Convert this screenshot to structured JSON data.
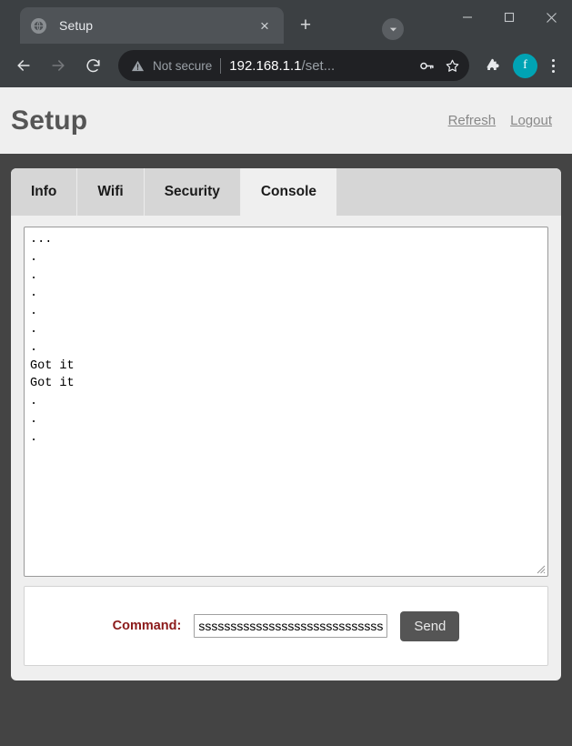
{
  "browser": {
    "tab": {
      "favicon": "globe-icon",
      "title": "Setup",
      "close_label": "×"
    },
    "new_tab_label": "+",
    "tab_search_icon": "chevron-down-icon",
    "window_controls": {
      "minimize": "—",
      "maximize": "☐",
      "close": "✕"
    },
    "toolbar": {
      "back_icon": "arrow-left-icon",
      "forward_icon": "arrow-right-icon",
      "reload_icon": "reload-icon",
      "security_icon": "warning-triangle-icon",
      "security_label": "Not secure",
      "url_host": "192.168.1.1",
      "url_path": "/set...",
      "password_icon": "key-icon",
      "bookmark_icon": "star-icon",
      "extensions_icon": "puzzle-piece-icon",
      "profile_initial": "f",
      "profile_color": "#00a3b4",
      "menu_icon": "three-dot-menu-icon"
    }
  },
  "page": {
    "header": {
      "title": "Setup",
      "links": [
        {
          "label": "Refresh",
          "name": "refresh-link"
        },
        {
          "label": "Logout",
          "name": "logout-link"
        }
      ]
    },
    "tabs": [
      {
        "label": "Info",
        "active": false
      },
      {
        "label": "Wifi",
        "active": false
      },
      {
        "label": "Security",
        "active": false
      },
      {
        "label": "Console",
        "active": true
      }
    ],
    "console": {
      "text": "...\n.\n.\n.\n.\n.\n.\nGot it\nGot it\n.\n.\n.",
      "lines": [
        "...",
        ".",
        ".",
        ".",
        ".",
        ".",
        ".",
        "Got it",
        "Got it",
        ".",
        ".",
        "."
      ]
    },
    "command_form": {
      "label": "Command:",
      "input_value": "ssssssssssssssssssssssssssssssssssssssss",
      "input_placeholder": "",
      "send_label": "Send"
    },
    "colors": {
      "page_background": "#444444",
      "panel_background": "#efefef",
      "tab_inactive": "#d6d6d6",
      "label_accent": "#8b1a1a",
      "button_background": "#555555"
    }
  }
}
